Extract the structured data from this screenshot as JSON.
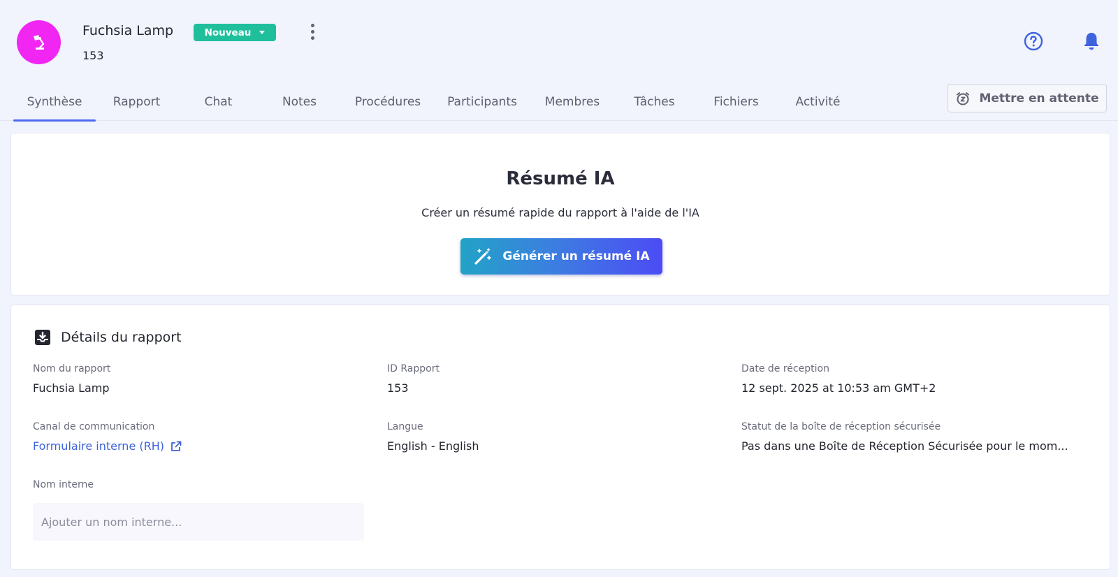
{
  "header": {
    "title": "Fuchsia Lamp",
    "report_id": "153",
    "status": "Nouveau"
  },
  "tabs": [
    {
      "label": "Synthèse",
      "active": true
    },
    {
      "label": "Rapport"
    },
    {
      "label": "Chat"
    },
    {
      "label": "Notes"
    },
    {
      "label": "Procédures"
    },
    {
      "label": "Participants"
    },
    {
      "label": "Membres"
    },
    {
      "label": "Tâches"
    },
    {
      "label": "Fichiers"
    },
    {
      "label": "Activité"
    }
  ],
  "snooze_label": "Mettre en attente",
  "ai_summary": {
    "title": "Résumé IA",
    "subtitle": "Créer un résumé rapide du rapport à l'aide de l'IA",
    "button_label": "Générer un résumé IA"
  },
  "details": {
    "heading": "Détails du rapport",
    "report_name_label": "Nom du rapport",
    "report_name": "Fuchsia Lamp",
    "report_id_label": "ID Rapport",
    "report_id": "153",
    "received_label": "Date de réception",
    "received": "12 sept. 2025 at 10:53 am GMT+2",
    "channel_label": "Canal de communication",
    "channel": "Formulaire interne (RH)",
    "language_label": "Langue",
    "language": "English - English",
    "secure_inbox_label": "Statut de la boîte de réception sécurisée",
    "secure_inbox": "Pas dans une Boîte de Réception Sécurisée pour le mom...",
    "internal_name_label": "Nom interne",
    "internal_name_placeholder": "Ajouter un nom interne..."
  },
  "colors": {
    "avatar": "#f226f2",
    "status_badge": "#1fbf9c",
    "accent": "#4f6bed",
    "link": "#3e63dd"
  },
  "icons": {
    "avatar": "lamp-icon",
    "help": "help-circle-icon",
    "notifications": "bell-icon",
    "snooze": "alarm-snooze-icon",
    "ai_button": "magic-wand-icon",
    "details": "inbox-download-icon",
    "channel_link": "external-link-icon"
  }
}
